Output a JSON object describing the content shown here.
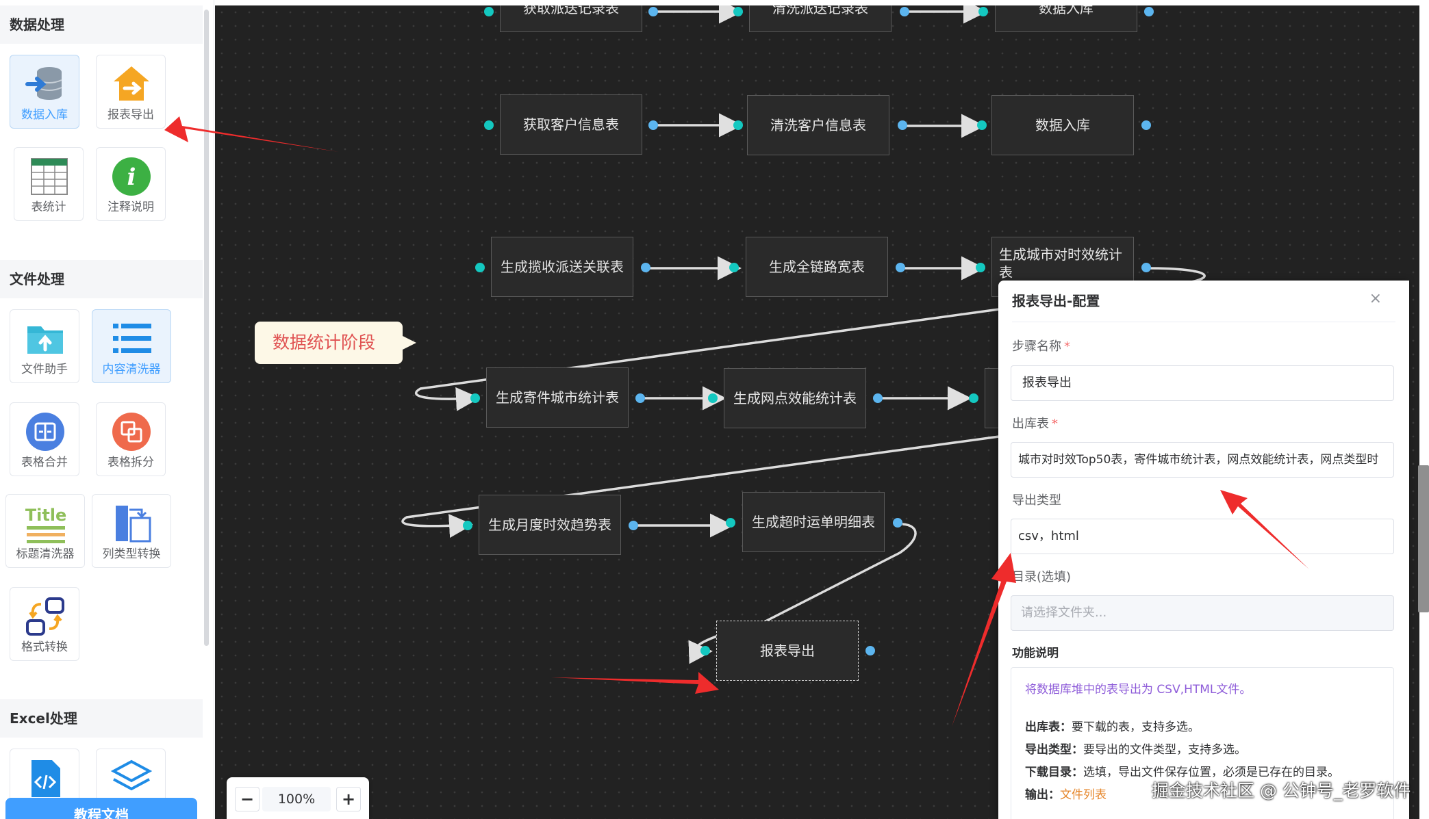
{
  "sidebar": {
    "sections": [
      {
        "title": "数据处理",
        "tools": [
          {
            "label": "数据入库",
            "icon": "database-import-icon",
            "active": true
          },
          {
            "label": "报表导出",
            "icon": "house-export-icon"
          },
          {
            "label": "表统计",
            "icon": "table-grid-icon"
          },
          {
            "label": "注释说明",
            "icon": "info-icon"
          }
        ]
      },
      {
        "title": "文件处理",
        "tools": [
          {
            "label": "文件助手",
            "icon": "folder-upload-icon"
          },
          {
            "label": "内容清洗器",
            "icon": "list-lines-icon",
            "active": true
          },
          {
            "label": "表格合并",
            "icon": "merge-icon"
          },
          {
            "label": "表格拆分",
            "icon": "split-icon"
          },
          {
            "label": "标题清洗器",
            "icon": "title-icon"
          },
          {
            "label": "列类型转换",
            "icon": "column-convert-icon"
          },
          {
            "label": "格式转换",
            "icon": "format-convert-icon"
          }
        ]
      },
      {
        "title": "Excel处理",
        "tools": [
          {
            "label": "",
            "icon": "code-file-icon"
          },
          {
            "label": "",
            "icon": "layers-icon"
          }
        ]
      }
    ],
    "doc_button": "教程文档"
  },
  "canvas": {
    "stage_label": "数据统计阶段",
    "nodes": [
      "获取派送记录表",
      "清洗派送记录表",
      "数据入库",
      "获取客户信息表",
      "清洗客户信息表",
      "数据入库",
      "生成揽收派送关联表",
      "生成全链路宽表",
      "生成城市对时效统计表",
      "生成寄件城市统计表",
      "生成网点效能统计表",
      "",
      "生成月度时效趋势表",
      "生成超时运单明细表",
      "报表导出"
    ],
    "zoom": {
      "minus": "−",
      "value": "100%",
      "plus": "+"
    }
  },
  "panel": {
    "title": "报表导出-配置",
    "close": "×",
    "step_name_label": "步骤名称",
    "step_name_value": "报表导出",
    "output_table_label": "出库表",
    "output_table_value": "城市对时效Top50表，寄件城市统计表，网点效能统计表，网点类型时",
    "export_type_label": "导出类型",
    "export_type_value": "csv，html",
    "dir_label": "目录(选填)",
    "dir_placeholder": "请选择文件夹...",
    "func_label": "功能说明",
    "desc": {
      "headline": "将数据库堆中的表导出为 CSV,HTML文件。",
      "k1": "出库表：",
      "v1": "要下载的表，支持多选。",
      "k2": "导出类型：",
      "v2": "要导出的文件类型，支持多选。",
      "k3": "下载目录：",
      "v3": "选填，导出文件保存位置，必须是已存在的目录。",
      "k4": "输出：",
      "v4": "文件列表"
    }
  },
  "watermark": "掘金技术社区 @ 公钟号_老罗软件",
  "colors": {
    "canvas_bg": "#222222",
    "port_in": "#14c8c0",
    "port_out": "#5cb5ef",
    "accent": "#409eff",
    "arrow_red": "#ee2c2c"
  }
}
